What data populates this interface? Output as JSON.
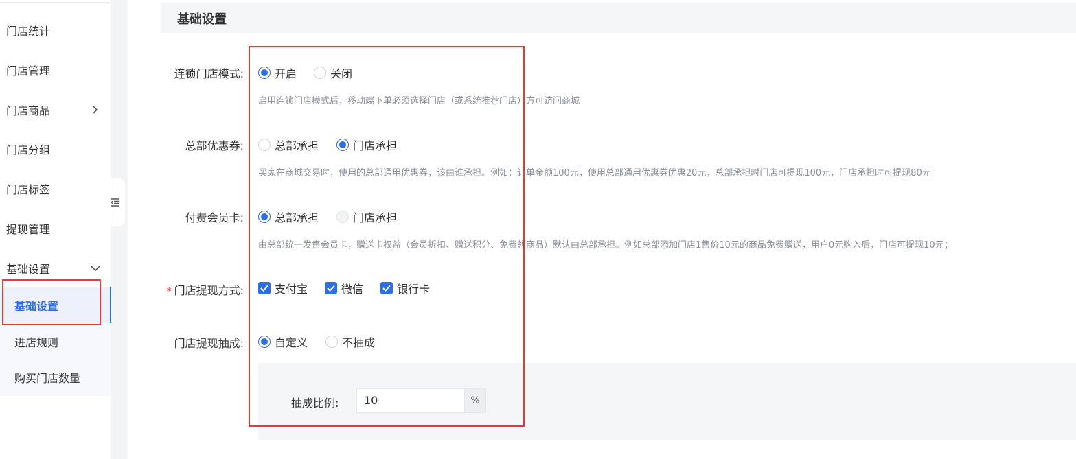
{
  "sidebar": {
    "items": [
      {
        "label": "门店统计"
      },
      {
        "label": "门店管理"
      },
      {
        "label": "门店商品"
      },
      {
        "label": "门店分组"
      },
      {
        "label": "门店标签"
      },
      {
        "label": "提现管理"
      },
      {
        "label": "基础设置"
      }
    ],
    "sub_items": [
      {
        "label": "基础设置",
        "active": true
      },
      {
        "label": "进店规则"
      },
      {
        "label": "购买门店数量"
      }
    ]
  },
  "section": {
    "title": "基础设置"
  },
  "form": {
    "chain_mode": {
      "label": "连锁门店模式:",
      "options": [
        "开启",
        "关闭"
      ],
      "selected": "开启",
      "hint": "启用连锁门店模式后，移动端下单必须选择门店（或系统推荐门店）方可访问商城"
    },
    "hq_coupon": {
      "label": "总部优惠券:",
      "options": [
        "总部承担",
        "门店承担"
      ],
      "selected": "门店承担",
      "hint": "买家在商城交易时，使用的总部通用优惠券，该由谁承担。例如：订单金额100元，使用总部通用优惠券优惠20元，总部承担时门店可提现100元，门店承担时可提现80元"
    },
    "member_card": {
      "label": "付费会员卡:",
      "options": [
        "总部承担",
        "门店承担"
      ],
      "selected": "总部承担",
      "hint": "由总部统一发售会员卡，赠送卡权益（会员折扣、赠送积分、免费领商品）默认由总部承担。例如总部添加门店1售价10元的商品免费赠送，用户0元购入后，门店可提现10元；"
    },
    "withdraw_method": {
      "required_mark": "*",
      "label": "门店提现方式:",
      "options": [
        "支付宝",
        "微信",
        "银行卡"
      ],
      "checked": [
        "支付宝",
        "微信",
        "银行卡"
      ]
    },
    "withdraw_commission": {
      "label": "门店提现抽成:",
      "options": [
        "自定义",
        "不抽成"
      ],
      "selected": "自定义",
      "ratio_label": "抽成比例:",
      "ratio_value": "10",
      "ratio_unit": "%"
    }
  },
  "colors": {
    "accent": "#2d6ee0",
    "highlight_box": "#e53935"
  }
}
